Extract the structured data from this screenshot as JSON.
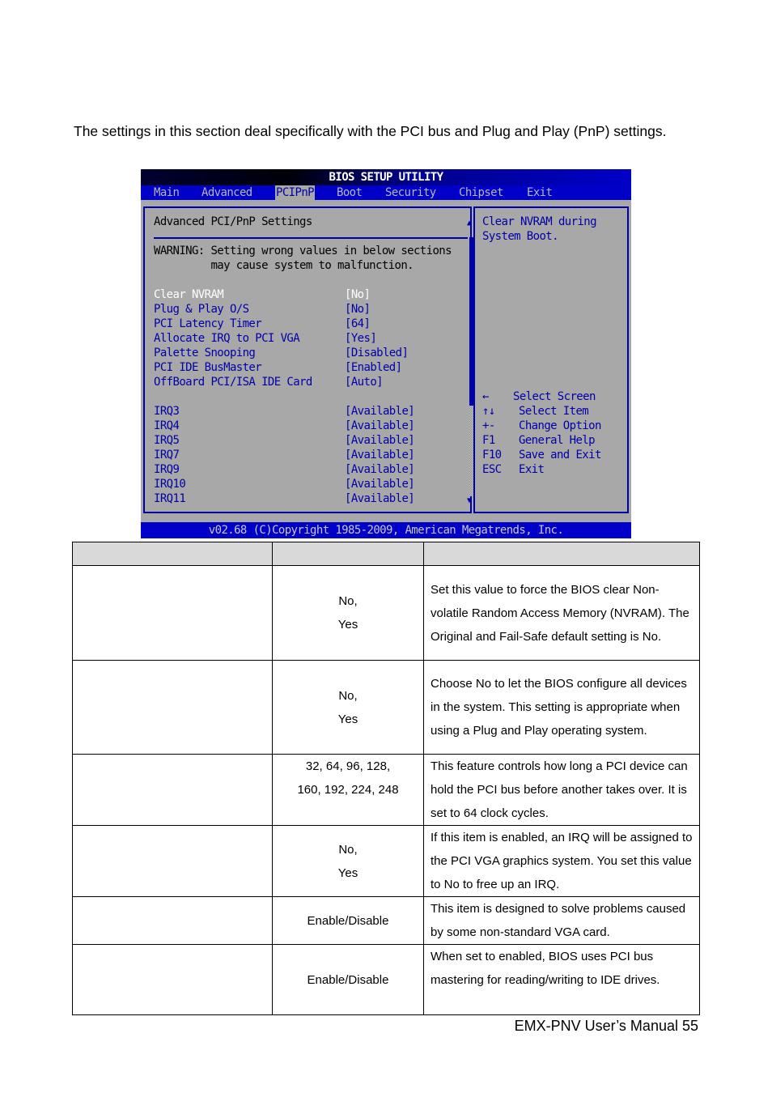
{
  "intro_text": "The settings in this section deal specifically with the PCI bus and Plug and Play (PnP) settings.",
  "bios": {
    "title": "BIOS SETUP UTILITY",
    "menu": [
      {
        "label": "Main",
        "active": false
      },
      {
        "label": "Advanced",
        "active": false
      },
      {
        "label": "PCIPnP",
        "active": true
      },
      {
        "label": "Boot",
        "active": false
      },
      {
        "label": "Security",
        "active": false
      },
      {
        "label": "Chipset",
        "active": false
      },
      {
        "label": "Exit",
        "active": false
      }
    ],
    "section_title": "Advanced PCI/PnP Settings",
    "warning_line1": "WARNING: Setting wrong values in below sections",
    "warning_line2": "         may cause system to malfunction.",
    "settings": [
      {
        "label": "Clear NVRAM",
        "value": "[No]",
        "selected": true
      },
      {
        "label": "Plug & Play O/S",
        "value": "[No]",
        "selected": false
      },
      {
        "label": "PCI Latency Timer",
        "value": "[64]",
        "selected": false
      },
      {
        "label": "Allocate IRQ to PCI VGA",
        "value": "[Yes]",
        "selected": false
      },
      {
        "label": "Palette Snooping",
        "value": "[Disabled]",
        "selected": false
      },
      {
        "label": "PCI IDE BusMaster",
        "value": "[Enabled]",
        "selected": false
      },
      {
        "label": "OffBoard PCI/ISA IDE Card",
        "value": "[Auto]",
        "selected": false
      }
    ],
    "irqs": [
      {
        "label": "IRQ3",
        "value": "[Available]"
      },
      {
        "label": "IRQ4",
        "value": "[Available]"
      },
      {
        "label": "IRQ5",
        "value": "[Available]"
      },
      {
        "label": "IRQ7",
        "value": "[Available]"
      },
      {
        "label": "IRQ9",
        "value": "[Available]"
      },
      {
        "label": "IRQ10",
        "value": "[Available]"
      },
      {
        "label": "IRQ11",
        "value": "[Available]"
      }
    ],
    "help_line1": "Clear NVRAM during",
    "help_line2": "System Boot.",
    "keys": [
      {
        "key": "←",
        "action": "Select Screen"
      },
      {
        "key": "↑↓",
        "action": "Select Item"
      },
      {
        "key": "+-",
        "action": "Change Option"
      },
      {
        "key": "F1",
        "action": "General Help"
      },
      {
        "key": "F10",
        "action": "Save and Exit"
      },
      {
        "key": "ESC",
        "action": "Exit"
      }
    ],
    "scroll_position": 0.65,
    "footer": "v02.68 (C)Copyright 1985-2009, American Megatrends, Inc."
  },
  "table": {
    "headers": [
      "",
      "",
      ""
    ],
    "rows": [
      {
        "item": "",
        "options": [
          "No,",
          "Yes"
        ],
        "description": "Set this value to force the BIOS clear Non-volatile Random Access Memory (NVRAM). The Original and Fail-Safe default setting is No."
      },
      {
        "item": "",
        "options": [
          "No,",
          "Yes"
        ],
        "description": "Choose No to let the BIOS configure all devices in the system. This setting is appropriate when using a Plug and Play operating system."
      },
      {
        "item": "",
        "options": [
          "32, 64, 96, 128,",
          "160, 192, 224, 248"
        ],
        "description": "This feature controls how long a PCI device can hold the PCI bus before another takes over. It is set to 64 clock cycles."
      },
      {
        "item": "",
        "options": [
          "No,",
          "Yes"
        ],
        "description": "If this item is enabled, an IRQ will be assigned to the PCI VGA graphics system. You set this value to No to free up an IRQ."
      },
      {
        "item": "",
        "options": [
          "Enable/Disable"
        ],
        "description": "This item is designed to solve problems caused by some non-standard VGA card."
      },
      {
        "item": "",
        "options": [
          "Enable/Disable"
        ],
        "description": "When set to enabled, BIOS uses PCI bus mastering for reading/writing to IDE drives."
      }
    ]
  },
  "page_footer": "EMX-PNV  User’s  Manual 55"
}
